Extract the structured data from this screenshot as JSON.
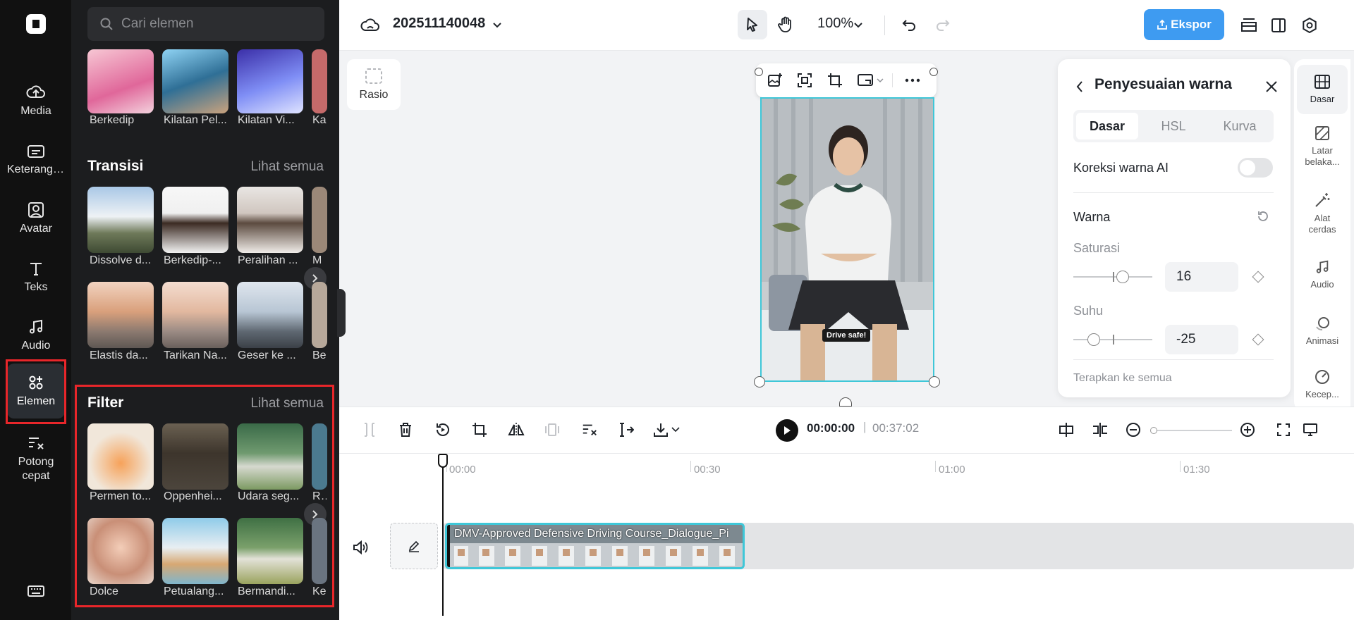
{
  "rail": {
    "items": [
      {
        "label": "Media",
        "icon": "cloud-upload-icon"
      },
      {
        "label": "Keterangan",
        "icon": "captions-icon"
      },
      {
        "label": "Avatar",
        "icon": "avatar-icon"
      },
      {
        "label": "Teks",
        "icon": "text-icon"
      },
      {
        "label": "Audio",
        "icon": "music-note-icon"
      },
      {
        "label": "Elemen",
        "icon": "elements-icon",
        "active": true
      },
      {
        "label": "Potong cepat",
        "icon": "quick-cut-icon"
      }
    ],
    "bottom_icon": "keyboard-icon"
  },
  "panel": {
    "search_placeholder": "Cari elemen",
    "top_row": [
      "Berkedip",
      "Kilatan Pel...",
      "Kilatan Vi...",
      "Ka"
    ],
    "transitions": {
      "title": "Transisi",
      "see_all": "Lihat semua",
      "row1": [
        "Dissolve d...",
        "Berkedip-...",
        "Peralihan ...",
        "M"
      ],
      "row2": [
        "Elastis da...",
        "Tarikan Na...",
        "Geser ke ...",
        "Be"
      ]
    },
    "filters": {
      "title": "Filter",
      "see_all": "Lihat semua",
      "row1": [
        "Permen to...",
        "Oppenhei...",
        "Udara seg...",
        "Ra"
      ],
      "row2": [
        "Dolce",
        "Petualang...",
        "Bermandi...",
        "Ke"
      ]
    }
  },
  "topbar": {
    "project_name": "202511140048",
    "zoom": "100%",
    "export_label": "Ekspor"
  },
  "canvas": {
    "rasio_label": "Rasio",
    "caption": "Drive safe!"
  },
  "color_panel": {
    "title": "Penyesuaian warna",
    "tabs": [
      "Dasar",
      "HSL",
      "Kurva"
    ],
    "ai_correction_label": "Koreksi warna AI",
    "ai_correction_on": false,
    "color_section": "Warna",
    "saturation_label": "Saturasi",
    "saturation_value": "16",
    "temperature_label": "Suhu",
    "temperature_value": "-25",
    "apply_all": "Terapkan ke semua"
  },
  "right_tabs": [
    {
      "label": "Dasar",
      "icon": "basic-adjust-icon",
      "active": true
    },
    {
      "label": "Latar belaka...",
      "icon": "background-icon"
    },
    {
      "label": "Alat cerdas",
      "icon": "magic-wand-icon"
    },
    {
      "label": "Audio",
      "icon": "music-note-icon"
    },
    {
      "label": "Animasi",
      "icon": "animation-icon"
    },
    {
      "label": "Kecep...",
      "icon": "speed-icon"
    }
  ],
  "timeline": {
    "current_time": "00:00:00",
    "separator": "|",
    "total_time": "00:37:02",
    "ruler": [
      "00:00",
      "00:30",
      "01:00",
      "01:30"
    ],
    "clip_title": "DMV-Approved Defensive Driving Course_Dialogue_Pi"
  }
}
